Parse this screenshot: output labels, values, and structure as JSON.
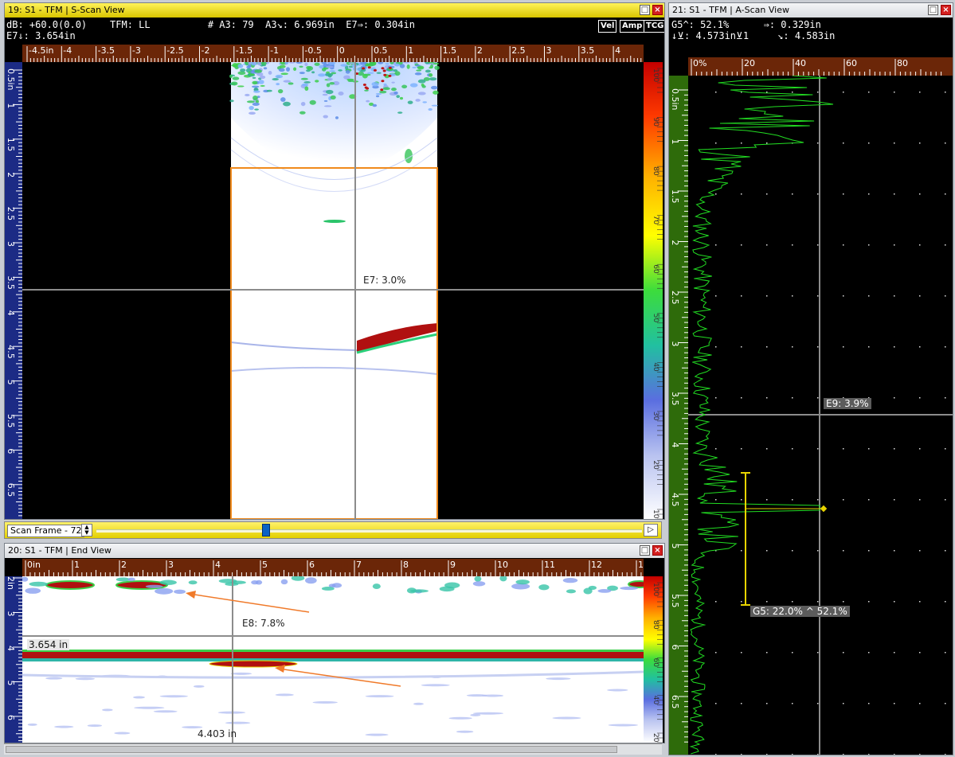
{
  "sscan": {
    "title": "19: S1 - TFM | S-Scan View",
    "info_line1": "dB: +60.0(0.0)    TFM: LL          # A3: 79  A3↘: 6.969in  E7⇒: 0.304in",
    "info_line2": "E7⇓: 3.654in",
    "tools": [
      "Vel",
      "Amp",
      "TCG"
    ],
    "ruler_x_labels": [
      "-4.5in",
      "-4",
      "-3.5",
      "-3",
      "-2.5",
      "-2",
      "-1.5",
      "-1",
      "-0.5",
      "0",
      "0.5",
      "1",
      "1.5",
      "2",
      "2.5",
      "3",
      "3.5",
      "4"
    ],
    "ruler_y_labels": [
      "0.5in",
      "1",
      "1.5",
      "2",
      "2.5",
      "3",
      "3.5",
      "4",
      "4.5",
      "5",
      "5.5",
      "6",
      "6.5"
    ],
    "cursor_label": "E7: 3.0%",
    "palette_labels": [
      "100",
      "90",
      "80",
      "70",
      "60",
      "50",
      "40",
      "30",
      "20",
      "10%"
    ]
  },
  "scanframe": {
    "label": "Scan Frame - 72",
    "spin_up": "▲",
    "spin_down": "▼",
    "play": "▷"
  },
  "endview": {
    "title": "20: S1 - TFM | End View",
    "ruler_x_labels": [
      "0in",
      "1",
      "2",
      "3",
      "4",
      "5",
      "6",
      "7",
      "8",
      "9",
      "10",
      "11",
      "12",
      "1"
    ],
    "ruler_y_labels": [
      "2in",
      "3",
      "4",
      "5",
      "6"
    ],
    "cursor_label": "E8: 7.8%",
    "depth_label": "3.654 in",
    "position_label": "4.403 in",
    "palette_labels": [
      "100",
      "80",
      "60",
      "40",
      "20%"
    ]
  },
  "ascan": {
    "title": "21: S1 - TFM | A-Scan View",
    "info_line1": "G5^: 52.1%      ⇒: 0.329in",
    "info_line2": "↓⊻: 4.573in⊻1     ↘: 4.583in",
    "ruler_x_labels": [
      "0%",
      "20",
      "40",
      "60",
      "80"
    ],
    "ruler_y_labels": [
      "0.5in",
      "1",
      "1.5",
      "2",
      "2.5",
      "3",
      "3.5",
      "4",
      "4.5",
      "5",
      "5.5",
      "6",
      "6.5"
    ],
    "cursor_label": "E9: 3.9%",
    "gate_label": "G5: 22.0% ^ 52.1%"
  },
  "buttons": {
    "restore": "□",
    "close": "×"
  },
  "colors": {
    "active_title": "#e6d300",
    "ruler_brown": "#6b2608",
    "ruler_blue": "#1c2b85",
    "ruler_green": "#2e6b0a",
    "signal_green": "#22dd22",
    "gate_yellow": "#e8d400",
    "arrow_orange": "#f07a2a",
    "selection_orange": "#f08a1c"
  }
}
